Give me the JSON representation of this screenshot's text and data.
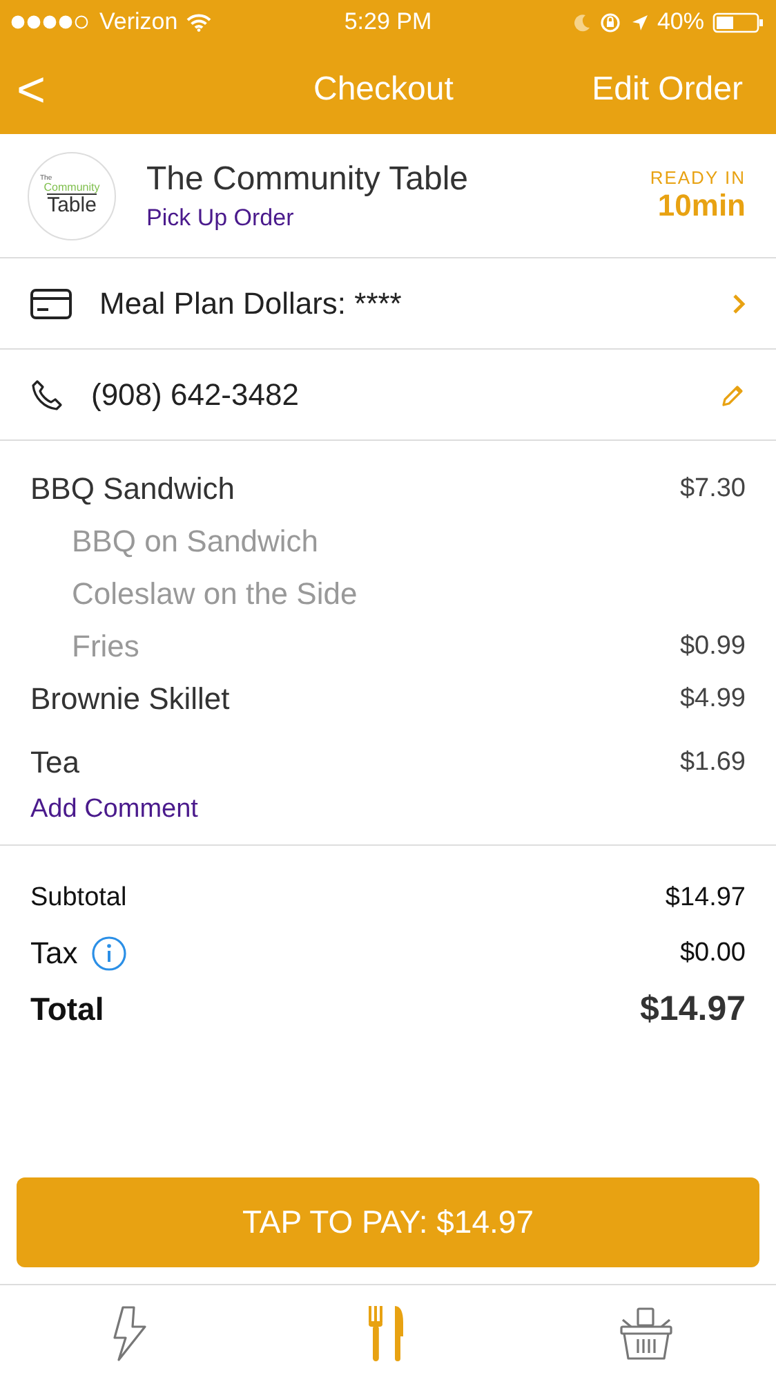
{
  "status_bar": {
    "carrier": "Verizon",
    "time": "5:29 PM",
    "battery": "40%"
  },
  "nav": {
    "back": "<",
    "title": "Checkout",
    "action": "Edit Order"
  },
  "restaurant": {
    "logo": [
      "The",
      "Community",
      "Table"
    ],
    "name": "The Community Table",
    "order_type": "Pick Up Order",
    "ready_label": "READY IN",
    "ready_time": "10min"
  },
  "payment": {
    "label": "Meal Plan Dollars: ****"
  },
  "phone": {
    "number": "(908) 642-3482"
  },
  "items": [
    {
      "kind": "item",
      "name": "BBQ Sandwich",
      "price": "$7.30"
    },
    {
      "kind": "option",
      "name": "BBQ on Sandwich"
    },
    {
      "kind": "option",
      "name": "Coleslaw on the Side"
    },
    {
      "kind": "option",
      "name": "Fries",
      "price": "$0.99"
    },
    {
      "kind": "item",
      "name": "Brownie Skillet",
      "price": "$4.99"
    },
    {
      "kind": "item",
      "name": "Tea",
      "price": "$1.69"
    }
  ],
  "add_comment": "Add Comment",
  "totals": [
    {
      "kind": "plain",
      "label": "Subtotal",
      "value": "$14.97"
    },
    {
      "kind": "info",
      "label": "Tax",
      "value": "$0.00"
    },
    {
      "kind": "total",
      "label": "Total",
      "value": "$14.97"
    }
  ],
  "pay_button": "TAP TO PAY: $14.97",
  "tabs": [
    {
      "kind": "bolt",
      "selected": false
    },
    {
      "kind": "utensils",
      "selected": true
    },
    {
      "kind": "basket",
      "selected": false
    }
  ]
}
